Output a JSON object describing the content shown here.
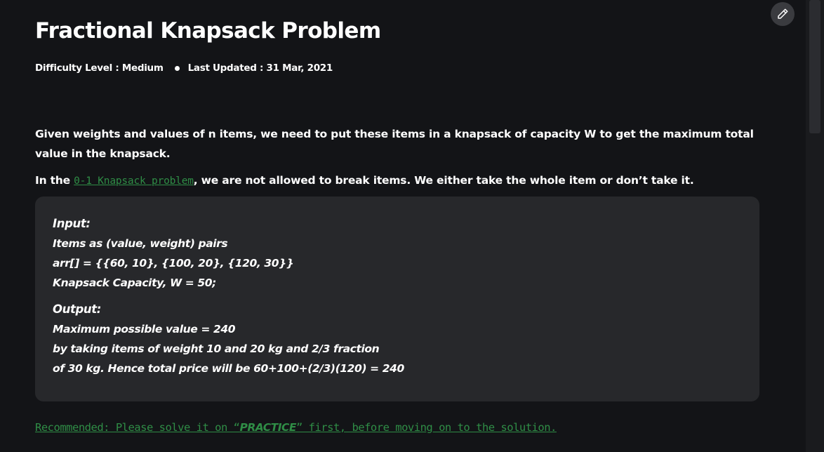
{
  "article": {
    "title": "Fractional Knapsack Problem",
    "difficulty": "Difficulty Level : Medium",
    "last_updated": "Last Updated : 31 Mar, 2021"
  },
  "body": {
    "para1": "Given weights and values of n items, we need to put these items in a knapsack of capacity W to get the maximum total value in the knapsack.",
    "para2_prefix": "In the ",
    "para2_link": "0-1 Knapsack problem",
    "para2_suffix": ", we are not allowed to break items. We either take the whole item or don’t take it."
  },
  "example": {
    "input_heading": "Input:",
    "input_lines": [
      "Items as (value, weight) pairs",
      "arr[] = {{60, 10}, {100, 20}, {120, 30}}",
      "Knapsack Capacity, W = 50;"
    ],
    "output_heading": "Output:",
    "output_lines": [
      "Maximum possible value = 240",
      "by taking items of weight 10 and 20 kg and 2/3 fraction",
      "of 30 kg. Hence total price will be 60+100+(2/3)(120) = 240"
    ]
  },
  "recommendation": {
    "prefix": "Recommended: Please solve it on “",
    "practice": "PRACTICE",
    "suffix": "” first, before moving on to the solution."
  },
  "icons": {
    "edit": "pencil-icon"
  },
  "colors": {
    "background": "#131417",
    "box": "#27282b",
    "link": "#2f8d46"
  }
}
